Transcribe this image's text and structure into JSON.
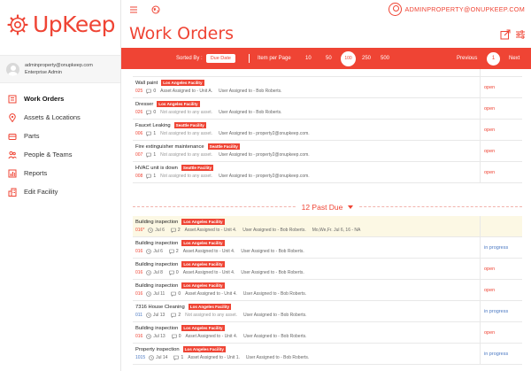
{
  "brand": {
    "name": "UpKeep"
  },
  "user": {
    "email": "adminproperty@onupkeep.com",
    "role": "Enterprise Admin"
  },
  "account": {
    "email": "ADMINPROPERTY@ONUPKEEP.COM"
  },
  "sidebar": {
    "items": [
      {
        "label": "Work Orders",
        "icon": "work-orders-icon"
      },
      {
        "label": "Assets & Locations",
        "icon": "location-pin-icon"
      },
      {
        "label": "Parts",
        "icon": "parts-icon"
      },
      {
        "label": "People & Teams",
        "icon": "people-icon"
      },
      {
        "label": "Reports",
        "icon": "reports-icon"
      },
      {
        "label": "Edit Facility",
        "icon": "facility-icon"
      }
    ]
  },
  "header": {
    "title": "Work Orders"
  },
  "toolbar": {
    "sorted_by_label": "Sorted By :",
    "sorted_by_value": "Due Date",
    "items_per_page_label": "Item per Page",
    "per_page_options": [
      "10",
      "50",
      "100",
      "250",
      "500"
    ],
    "per_page_selected": "100",
    "previous": "Previous",
    "current_page": "1",
    "next": "Next"
  },
  "colors": {
    "accent": "#ef4434",
    "link_blue": "#4a78c2",
    "highlight": "#fcf8e4"
  },
  "upcoming": [
    {
      "title": "Wall paint",
      "facility": "Los Angeles Facility",
      "id": "025",
      "comments": "0",
      "asset": "Asset Assigned to - Unit A.",
      "user": "User Assigned to - Bob Roberts.",
      "status": "open"
    },
    {
      "title": "Dresser",
      "facility": "Los Angeles Facility",
      "id": "026",
      "comments": "0",
      "asset": "Not assigned to any asset.",
      "user": "User Assigned to - Bob Roberts.",
      "status": "open"
    },
    {
      "title": "Faucet Leaking",
      "facility": "Seattle Facility",
      "id": "006",
      "comments": "1",
      "asset": "Not assigned to any asset.",
      "user": "User Assigned to - property2@onupkeep.com.",
      "status": "open"
    },
    {
      "title": "Fire extinguisher maintenance",
      "facility": "Seattle Facility",
      "id": "007",
      "comments": "1",
      "asset": "Not assigned to any asset.",
      "user": "User Assigned to - property2@onupkeep.com.",
      "status": "open"
    },
    {
      "title": "HVAC unit is down",
      "facility": "Seattle Facility",
      "id": "008",
      "comments": "1",
      "asset": "Not assigned to any asset.",
      "user": "User Assigned to - property2@onupkeep.com.",
      "status": "open"
    }
  ],
  "past_due": {
    "label": "12 Past Due",
    "rows": [
      {
        "title": "Building inspection",
        "facility": "Los Angeles Facility",
        "id": "016*",
        "date": "Jul 6",
        "comments": "2",
        "asset": "Asset Assigned to - Unit 4.",
        "user": "User Assigned to - Bob Roberts.",
        "extra": "Mo,We,Fr. Jul 6, 16 - NA",
        "status": "",
        "highlight": true
      },
      {
        "title": "Building inspection",
        "facility": "Los Angeles Facility",
        "id": "016",
        "date": "Jul 6",
        "comments": "2",
        "asset": "Asset Assigned to - Unit 4.",
        "user": "User Assigned to - Bob Roberts.",
        "extra": "",
        "status": "in progress",
        "highlight": false
      },
      {
        "title": "Building inspection",
        "facility": "Los Angeles Facility",
        "id": "016",
        "date": "Jul 8",
        "comments": "0",
        "asset": "Asset Assigned to - Unit 4.",
        "user": "User Assigned to - Bob Roberts.",
        "extra": "",
        "status": "open",
        "highlight": false
      },
      {
        "title": "Building inspection",
        "facility": "Los Angeles Facility",
        "id": "016",
        "date": "Jul 11",
        "comments": "0",
        "asset": "Asset Assigned to - Unit 4.",
        "user": "User Assigned to - Bob Roberts.",
        "extra": "",
        "status": "open",
        "highlight": false
      },
      {
        "title": "7316 House Cleaning",
        "facility": "Los Angeles Facility",
        "id": "011",
        "date": "Jul 13",
        "comments": "2",
        "asset": "Not assigned to any asset.",
        "user": "User Assigned to - Bob Roberts.",
        "extra": "",
        "status": "in progress",
        "highlight": false
      },
      {
        "title": "Building inspection",
        "facility": "Los Angeles Facility",
        "id": "016",
        "date": "Jul 13",
        "comments": "0",
        "asset": "Asset Assigned to - Unit 4.",
        "user": "User Assigned to - Bob Roberts.",
        "extra": "",
        "status": "open",
        "highlight": false
      },
      {
        "title": "Property inspection",
        "facility": "Los Angeles Facility",
        "id": "1015",
        "date": "Jul 14",
        "comments": "1",
        "asset": "Asset Assigned to - Unit 1.",
        "user": "User Assigned to - Bob Roberts.",
        "extra": "",
        "status": "in progress",
        "highlight": false
      }
    ]
  }
}
